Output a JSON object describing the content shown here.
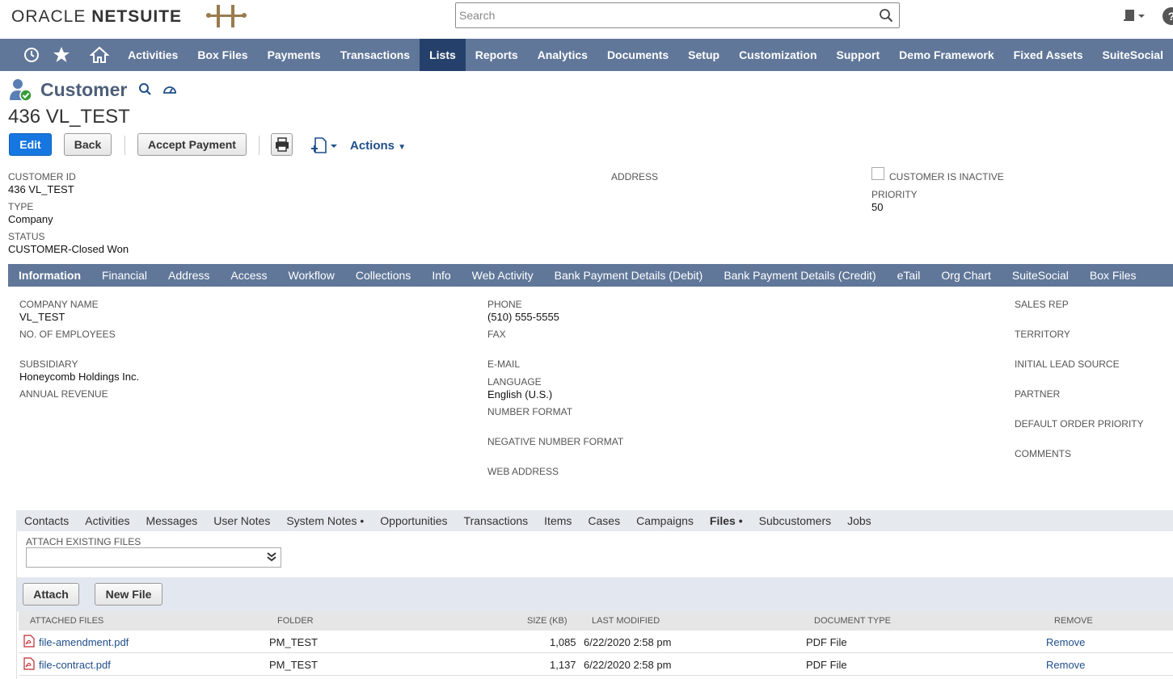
{
  "header": {
    "logo_oracle": "ORACLE",
    "logo_netsuite": "NETSUITE",
    "search_placeholder": "Search"
  },
  "nav": {
    "items": [
      "Activities",
      "Box Files",
      "Payments",
      "Transactions",
      "Lists",
      "Reports",
      "Analytics",
      "Documents",
      "Setup",
      "Customization",
      "Support",
      "Demo Framework",
      "Fixed Assets",
      "SuiteSocial"
    ],
    "active": "Lists"
  },
  "record": {
    "type": "Customer",
    "name": "436 VL_TEST"
  },
  "buttons": {
    "edit": "Edit",
    "back": "Back",
    "accept_payment": "Accept Payment",
    "actions": "Actions"
  },
  "primary_fields": {
    "customer_id_label": "CUSTOMER ID",
    "customer_id": "436 VL_TEST",
    "type_label": "TYPE",
    "type": "Company",
    "status_label": "STATUS",
    "status": "CUSTOMER-Closed Won",
    "address_label": "ADDRESS",
    "inactive_label": "CUSTOMER IS INACTIVE",
    "inactive_checked": false,
    "priority_label": "PRIORITY",
    "priority": "50"
  },
  "main_tabs": [
    "Information",
    "Financial",
    "Address",
    "Access",
    "Workflow",
    "Collections",
    "Info",
    "Web Activity",
    "Bank Payment Details (Debit)",
    "Bank Payment Details (Credit)",
    "eTail",
    "Org Chart",
    "SuiteSocial",
    "Box Files"
  ],
  "main_tabs_active": "Information",
  "info": {
    "company_name_label": "COMPANY NAME",
    "company_name": "VL_TEST",
    "employees_label": "NO. OF EMPLOYEES",
    "subsidiary_label": "SUBSIDIARY",
    "subsidiary": "Honeycomb Holdings Inc.",
    "annual_revenue_label": "ANNUAL REVENUE",
    "phone_label": "PHONE",
    "phone": "(510) 555-5555",
    "fax_label": "FAX",
    "email_label": "E-MAIL",
    "language_label": "LANGUAGE",
    "language": "English (U.S.)",
    "number_format_label": "NUMBER FORMAT",
    "negative_number_format_label": "NEGATIVE NUMBER FORMAT",
    "web_address_label": "WEB ADDRESS",
    "sales_rep_label": "SALES REP",
    "territory_label": "TERRITORY",
    "lead_source_label": "INITIAL LEAD SOURCE",
    "partner_label": "PARTNER",
    "order_priority_label": "DEFAULT ORDER PRIORITY",
    "comments_label": "COMMENTS"
  },
  "sub_tabs": [
    "Contacts",
    "Activities",
    "Messages",
    "User Notes",
    "System Notes •",
    "Opportunities",
    "Transactions",
    "Items",
    "Cases",
    "Campaigns",
    "Files •",
    "Subcustomers",
    "Jobs"
  ],
  "sub_tabs_active": "Files •",
  "files": {
    "attach_existing_label": "ATTACH EXISTING FILES",
    "attach_button": "Attach",
    "new_file_button": "New File",
    "columns": [
      "ATTACHED FILES",
      "FOLDER",
      "SIZE (KB)",
      "LAST MODIFIED",
      "DOCUMENT TYPE",
      "REMOVE"
    ],
    "rows": [
      {
        "name": "file-amendment.pdf",
        "folder": "PM_TEST",
        "size": "1,085",
        "modified": "6/22/2020 2:58 pm",
        "doctype": "PDF File",
        "remove": "Remove"
      },
      {
        "name": "file-contract.pdf",
        "folder": "PM_TEST",
        "size": "1,137",
        "modified": "6/22/2020 2:58 pm",
        "doctype": "PDF File",
        "remove": "Remove"
      }
    ]
  },
  "colors": {
    "nav_bg": "#607799",
    "nav_active": "#25416b",
    "edit_button": "#1677e0",
    "link": "#1f4e8a"
  }
}
